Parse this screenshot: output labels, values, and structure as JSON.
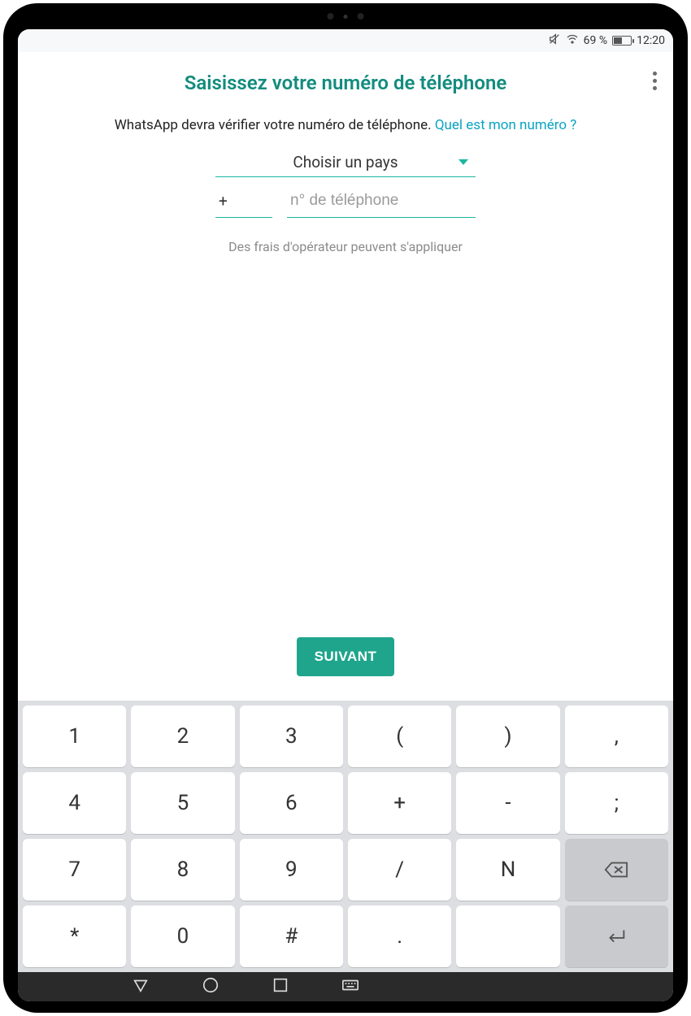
{
  "status_bar": {
    "battery_percent": "69 %",
    "time": "12:20"
  },
  "header": {
    "title": "Saisissez votre numéro de téléphone"
  },
  "content": {
    "verify_text": "WhatsApp devra vérifier votre numéro de téléphone. ",
    "verify_link": "Quel est mon numéro ?",
    "country_label": "Choisir un pays",
    "country_code_prefix": "+",
    "phone_placeholder": "n° de téléphone",
    "carrier_note": "Des frais d'opérateur peuvent s'appliquer",
    "next_label": "SUIVANT"
  },
  "keyboard": {
    "rows": [
      [
        "1",
        "2",
        "3",
        "(",
        ")",
        ","
      ],
      [
        "4",
        "5",
        "6",
        "+",
        "-",
        ";"
      ],
      [
        "7",
        "8",
        "9",
        "/",
        "N",
        "backspace"
      ],
      [
        "*",
        "0",
        "#",
        ".",
        "blank",
        "enter"
      ]
    ]
  }
}
